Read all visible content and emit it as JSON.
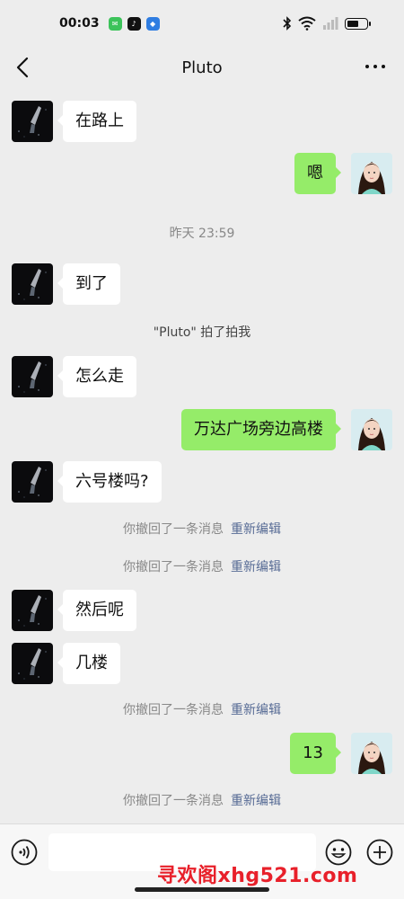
{
  "status_bar": {
    "time": "00:03",
    "icons": [
      "message-app-icon",
      "tiktok-icon",
      "app-shield-icon",
      "bluetooth-icon",
      "wifi-icon",
      "signal-icon",
      "battery-icon"
    ],
    "battery_level": 0.6
  },
  "header": {
    "title": "Pluto",
    "back_icon": "chevron-left-icon",
    "more_icon": "more-dots-icon"
  },
  "messages": {
    "m1": "在路上",
    "m2": "嗯",
    "time1": "昨天 23:59",
    "m3": "到了",
    "pat": "\"Pluto\" 拍了拍我",
    "m4": "怎么走",
    "m5": "万达广场旁边高楼",
    "m6": "六号楼吗?",
    "m7": "然后呢",
    "m8": "几楼",
    "m9": "13"
  },
  "recall": {
    "text": "你撤回了一条消息",
    "link": "重新编辑"
  },
  "input_bar": {
    "placeholder": "",
    "voice_icon": "voice-icon",
    "emoji_icon": "emoji-icon",
    "plus_icon": "plus-icon"
  },
  "watermark": "寻欢阁xhg521.com",
  "colors": {
    "background": "#ededed",
    "bubble_out": "#95ec69",
    "bubble_in": "#ffffff",
    "link": "#576b95",
    "watermark": "#e8202a"
  }
}
